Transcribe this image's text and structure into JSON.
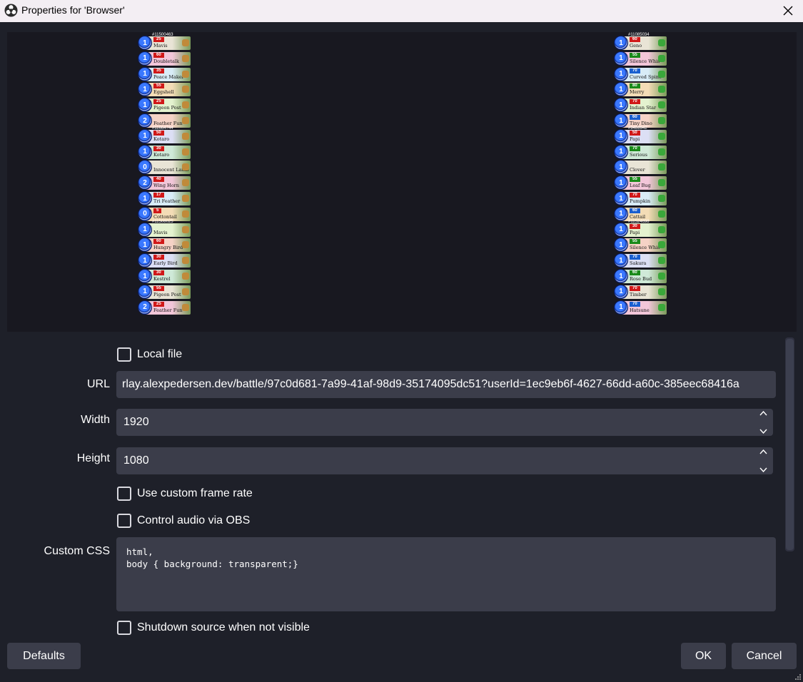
{
  "window": {
    "title": "Properties for 'Browser'"
  },
  "preview": {
    "left_deck": {
      "cards": [
        {
          "id": "#11500463",
          "count": "1",
          "name": "Mavis",
          "power": "25"
        },
        {
          "count": "1",
          "name": "Doubletalk",
          "power": "60"
        },
        {
          "count": "1",
          "name": "Peace Maker",
          "power": "35"
        },
        {
          "count": "1",
          "name": "Eggshell",
          "power": "55"
        },
        {
          "count": "1",
          "name": "Pigeon Post",
          "power": "25"
        },
        {
          "count": "2",
          "name": "Feather Fun",
          "power": ""
        },
        {
          "id": "#11664744",
          "count": "1",
          "name": "Kotaro",
          "power": "50"
        },
        {
          "count": "1",
          "name": "Kotaro",
          "power": "30"
        },
        {
          "count": "0",
          "name": "Innocent Lamb",
          "power": ""
        },
        {
          "count": "2",
          "name": "Wing Horn",
          "power": "40"
        },
        {
          "count": "1",
          "name": "Tri Feather",
          "power": "17"
        },
        {
          "count": "0",
          "name": "Cottontail",
          "power": "5"
        },
        {
          "id": "#11508025",
          "count": "1",
          "name": "Mavis",
          "power": ""
        },
        {
          "count": "1",
          "name": "Hungry Bird",
          "power": "60"
        },
        {
          "count": "1",
          "name": "Early Bird",
          "power": "30"
        },
        {
          "count": "1",
          "name": "Kestrel",
          "power": "30"
        },
        {
          "count": "1",
          "name": "Pigeon Post",
          "power": "55"
        },
        {
          "count": "2",
          "name": "Feather Fun",
          "power": "25"
        }
      ]
    },
    "right_deck": {
      "cards": [
        {
          "id": "#11085034",
          "count": "1",
          "name": "Geno",
          "power": "60"
        },
        {
          "count": "1",
          "name": "Silence Whis",
          "power": "55"
        },
        {
          "count": "1",
          "name": "Curved Spine",
          "power": "70"
        },
        {
          "count": "1",
          "name": "Merry",
          "power": "80"
        },
        {
          "count": "1",
          "name": "Indian Star",
          "power": "70"
        },
        {
          "count": "1",
          "name": "Tiny Dino",
          "power": "60"
        },
        {
          "id": "#9488942",
          "count": "1",
          "name": "Papi",
          "power": "50"
        },
        {
          "count": "1",
          "name": "Serious",
          "power": "70"
        },
        {
          "count": "1",
          "name": "Clover",
          "power": ""
        },
        {
          "count": "1",
          "name": "Leaf Bug",
          "power": "55"
        },
        {
          "count": "1",
          "name": "Pumpkin",
          "power": "70"
        },
        {
          "count": "1",
          "name": "Cattail",
          "power": "60"
        },
        {
          "id": "#11524698",
          "count": "1",
          "name": "Papi",
          "power": "30"
        },
        {
          "count": "1",
          "name": "Silence Whis",
          "power": "55"
        },
        {
          "count": "1",
          "name": "Sakura",
          "power": "70"
        },
        {
          "count": "1",
          "name": "Rose Bud",
          "power": "60"
        },
        {
          "count": "1",
          "name": "Timber",
          "power": "70"
        },
        {
          "count": "1",
          "name": "Hatsune",
          "power": "70"
        }
      ]
    }
  },
  "form": {
    "local_file_label": "Local file",
    "url_label": "URL",
    "url_value": "rlay.alexpedersen.dev/battle/97c0d681-7a99-41af-98d9-35174095dc51?userId=1ec9eb6f-4627-66dd-a60c-385eec68416a",
    "width_label": "Width",
    "width_value": "1920",
    "height_label": "Height",
    "height_value": "1080",
    "custom_frame_rate_label": "Use custom frame rate",
    "control_audio_label": "Control audio via OBS",
    "custom_css_label": "Custom CSS",
    "custom_css_value": "html,\nbody { background: transparent;}",
    "shutdown_label": "Shutdown source when not visible"
  },
  "buttons": {
    "defaults": "Defaults",
    "ok": "OK",
    "cancel": "Cancel"
  },
  "colors": {
    "background": "#1e2029",
    "field": "#3b3d4a",
    "preview_bg": "#181820",
    "titlebar": "#f3eef3"
  },
  "icons": {
    "app": "obs-logo-icon",
    "close": "close-icon",
    "spin_up": "chevron-up-icon",
    "spin_down": "chevron-down-icon"
  }
}
